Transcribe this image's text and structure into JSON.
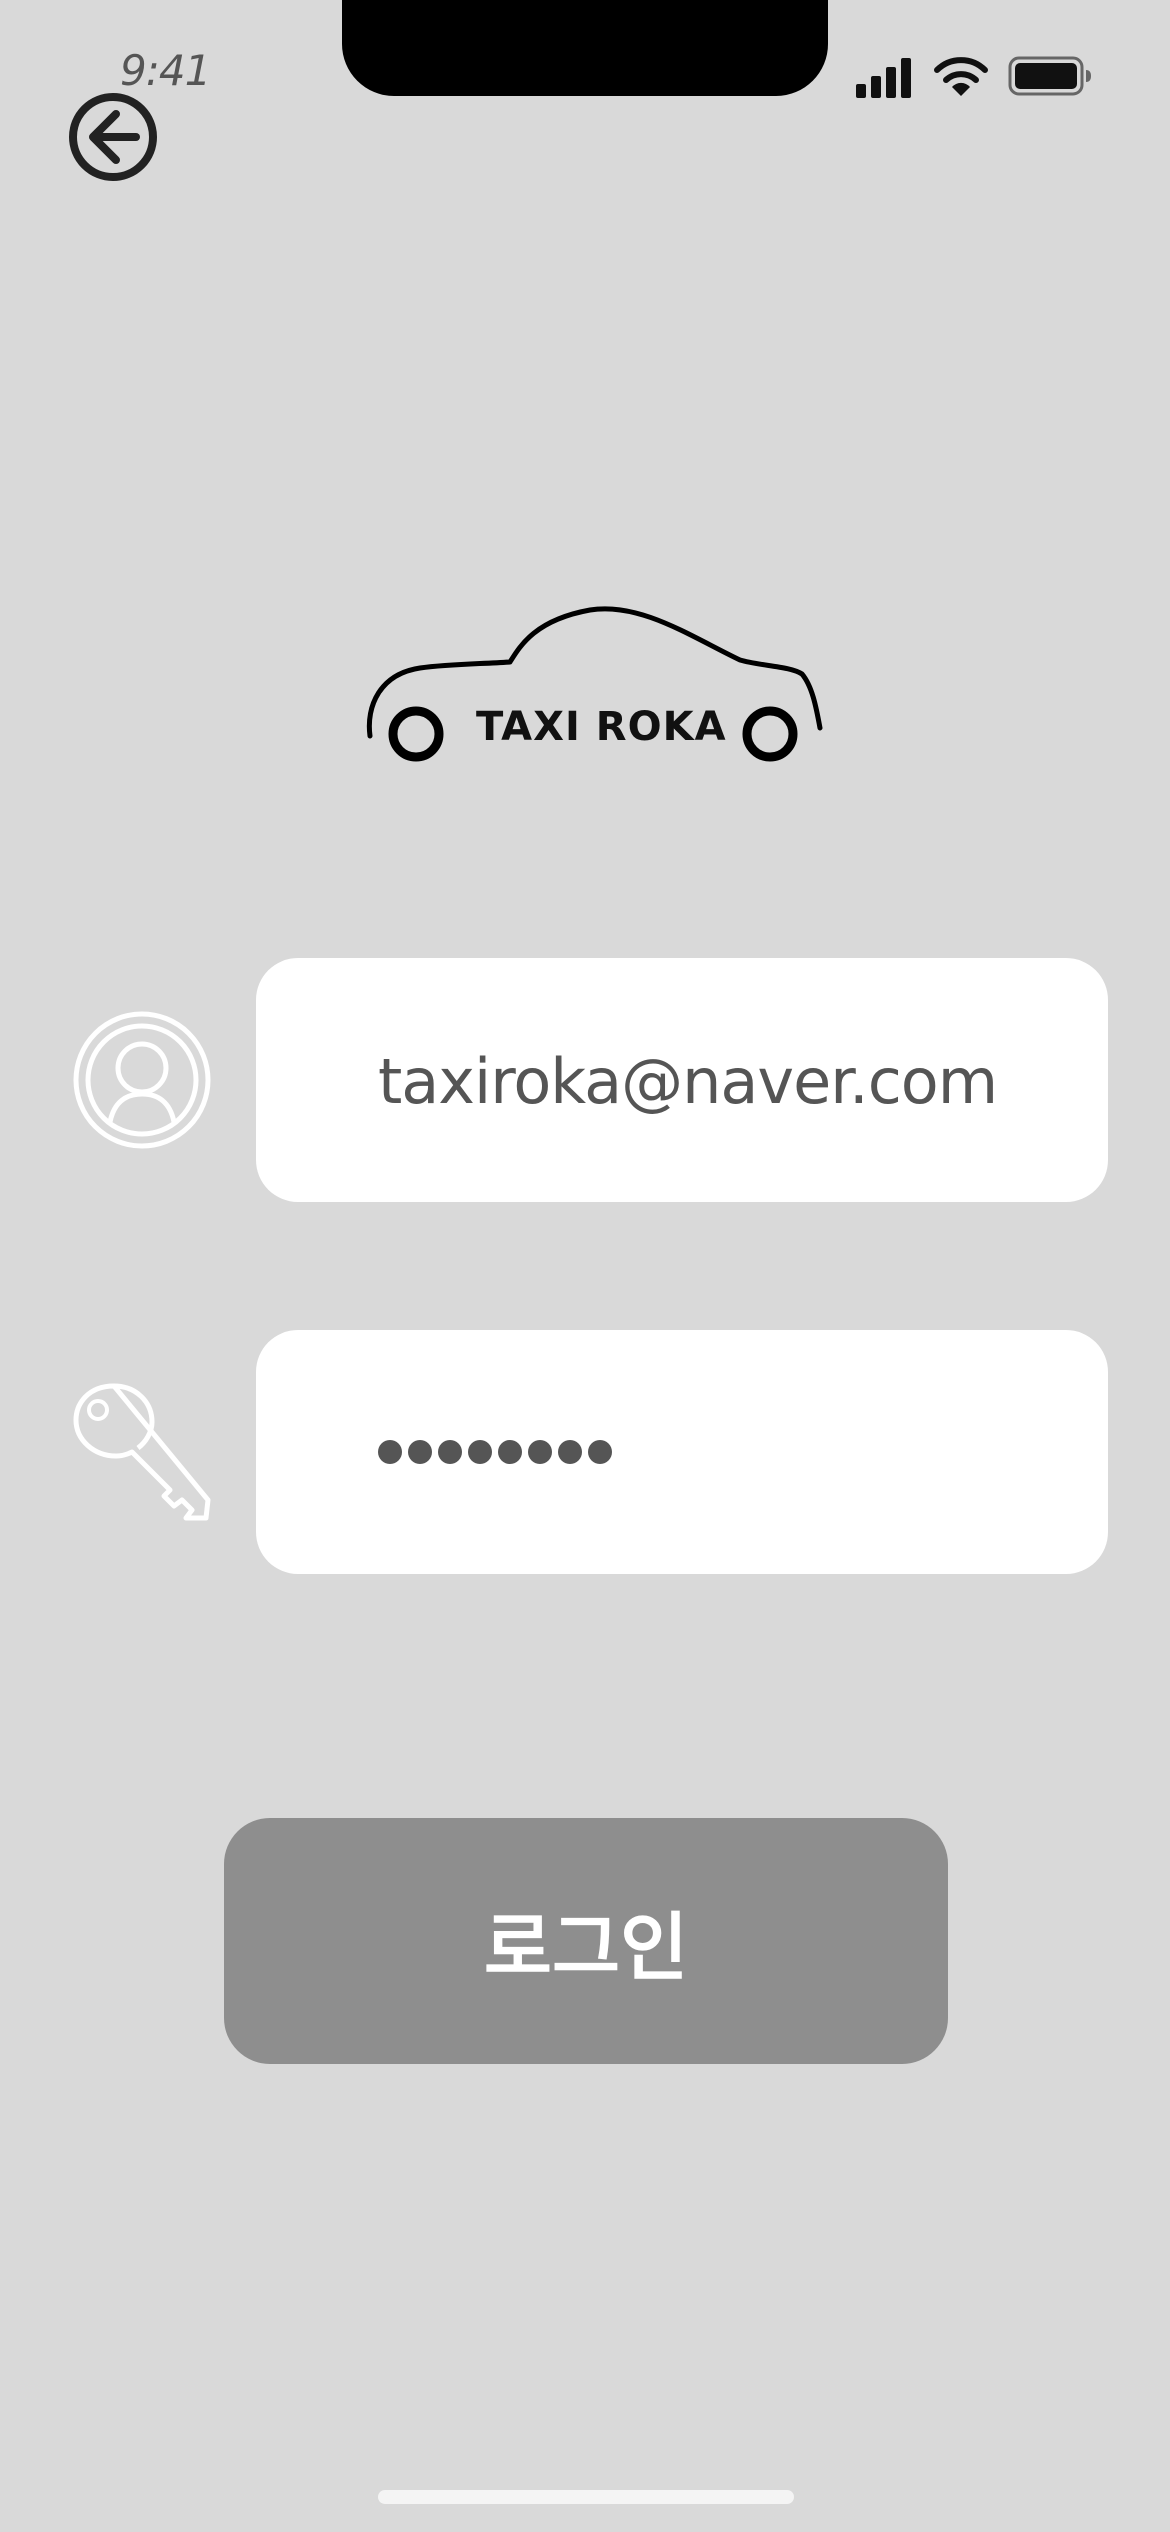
{
  "status_bar": {
    "time": "9:41",
    "signal_icon": "cellular-signal-icon",
    "wifi_icon": "wifi-icon",
    "battery_icon": "battery-icon"
  },
  "nav": {
    "back_icon": "arrow-left-circle-icon"
  },
  "logo": {
    "text": "TAXI ROKA",
    "icon": "car-outline-icon"
  },
  "form": {
    "email": {
      "icon": "user-circle-icon",
      "value": "taxiroka@naver.com"
    },
    "password": {
      "icon": "key-icon",
      "masked_length": 8
    },
    "submit_label": "로그인"
  },
  "colors": {
    "background": "#d9d9d9",
    "field_bg": "#ffffff",
    "button_bg": "#8e8e8e",
    "text_dark": "#555555"
  }
}
